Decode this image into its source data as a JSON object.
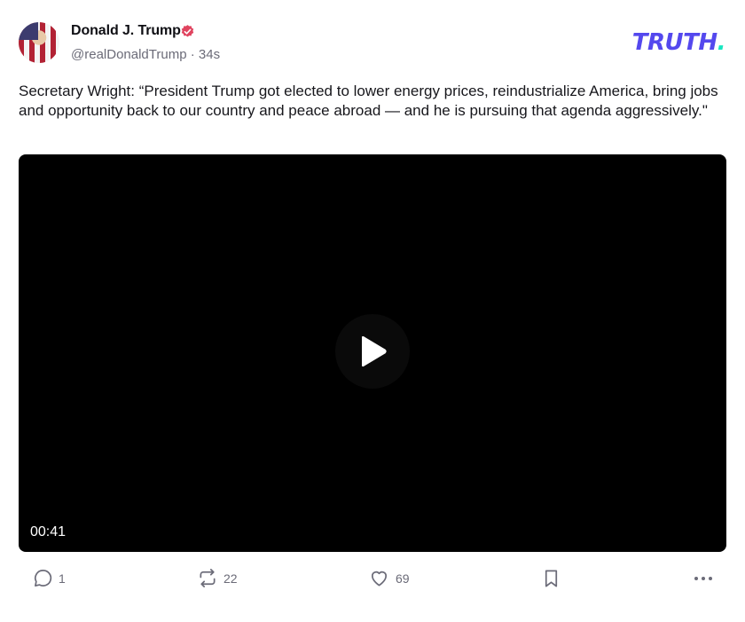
{
  "author": {
    "display_name": "Donald J. Trump",
    "handle": "@realDonaldTrump",
    "separator": "·",
    "time_ago": "34s"
  },
  "brand": {
    "logo_text": "TRUTH",
    "logo_dot": ".",
    "primary_color": "#5448ee",
    "accent_color": "#17e6c0"
  },
  "post": {
    "text": "Secretary Wright: “President Trump got elected to lower energy prices, reindustrialize America, bring jobs and opportunity back to our country and peace abroad — and he is pursuing that agenda aggressively.\""
  },
  "video": {
    "duration": "00:41",
    "play_icon": "play-icon"
  },
  "actions": {
    "replies": "1",
    "retruths": "22",
    "likes": "69"
  }
}
